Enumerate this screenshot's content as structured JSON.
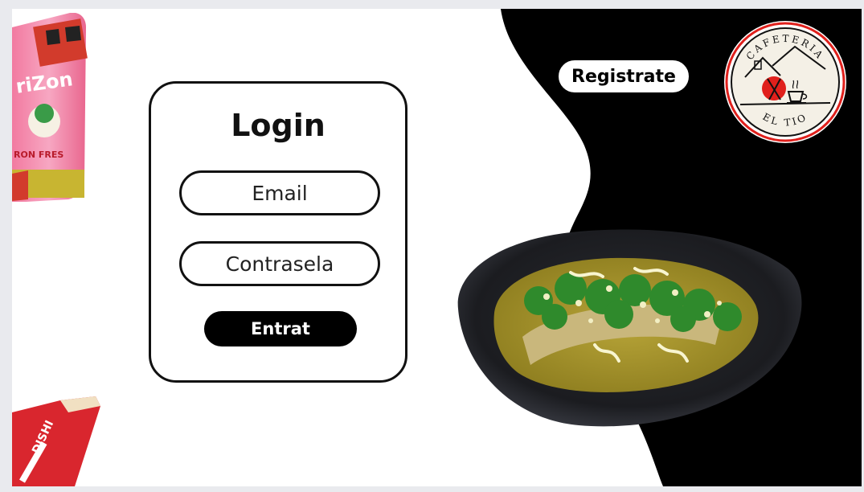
{
  "login": {
    "title": "Login",
    "email_placeholder": "Email",
    "password_placeholder": "Contrasela",
    "submit_label": "Entrat"
  },
  "header": {
    "register_label": "Registrate"
  },
  "logo": {
    "top_text": "CAFETERIA",
    "bottom_text": "EL TIO"
  },
  "colors": {
    "background": "#ffffff",
    "dark_panel": "#000000",
    "accent_red": "#e0201c",
    "text": "#111111"
  },
  "icons": {
    "logo": "cafeteria-logo-icon",
    "plate": "enchiladas-plate-image",
    "can": "arizona-can-image",
    "snack": "snack-bag-image"
  }
}
